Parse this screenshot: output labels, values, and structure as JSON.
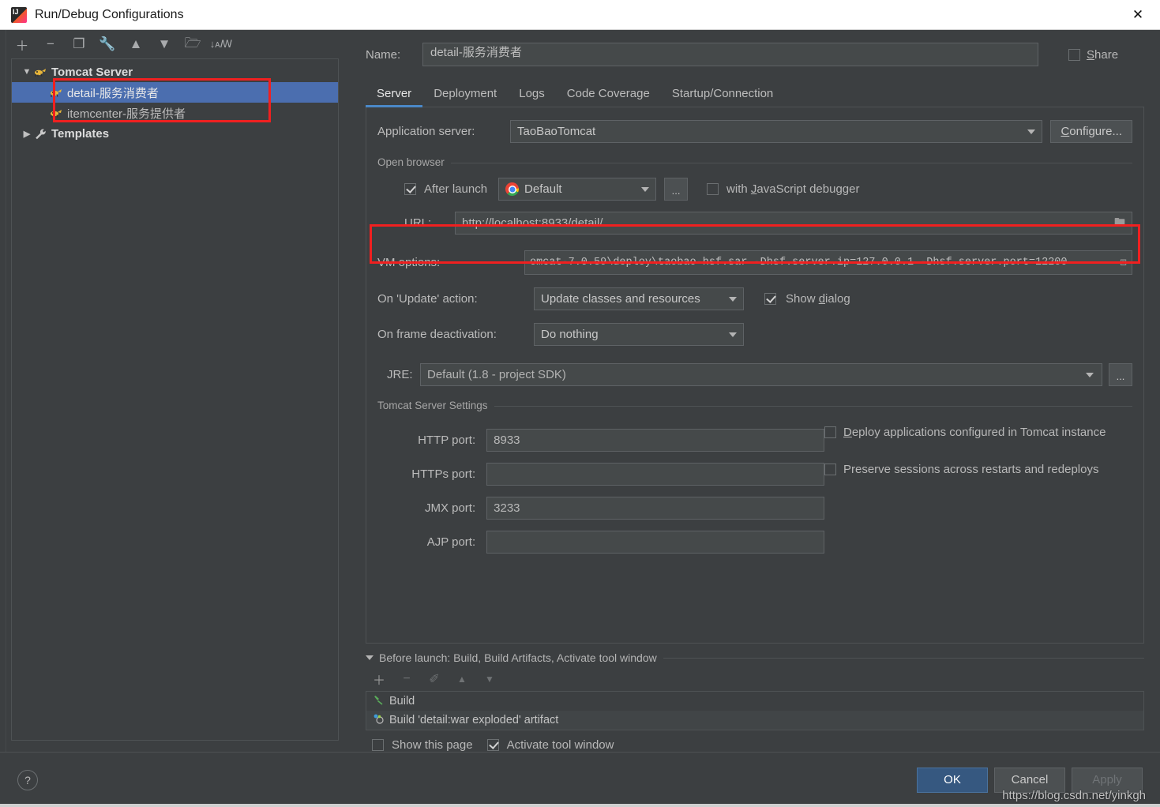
{
  "window": {
    "title": "Run/Debug Configurations",
    "app_icon": "intellij-idea-icon",
    "close_label": "✕"
  },
  "sidebar": {
    "toolbar": [
      {
        "name": "add-configuration-button",
        "glyph": "＋"
      },
      {
        "name": "remove-configuration-button",
        "glyph": "−"
      },
      {
        "name": "copy-configuration-button",
        "glyph": "❐"
      },
      {
        "name": "edit-templates-button",
        "glyph": "🔧"
      },
      {
        "name": "move-up-button",
        "glyph": "▲"
      },
      {
        "name": "move-down-button",
        "glyph": "▼"
      },
      {
        "name": "new-folder-button",
        "glyph": "🗁"
      },
      {
        "name": "sort-alphabetically-button",
        "glyph": "↓ᴀꟿ"
      }
    ],
    "tree": [
      {
        "label": "Tomcat Server",
        "type": "root",
        "expanded": true,
        "icon": "tomcat-icon"
      },
      {
        "label": "detail-服务消费者",
        "type": "child",
        "selected": true,
        "icon": "tomcat-icon"
      },
      {
        "label": "itemcenter-服务提供者",
        "type": "child",
        "selected": false,
        "icon": "tomcat-icon"
      },
      {
        "label": "Templates",
        "type": "root",
        "expanded": false,
        "icon": "wrench-icon"
      }
    ]
  },
  "header": {
    "name_label": "Name:",
    "name_value": "detail-服务消费者",
    "share_label": "Share",
    "share_checked": false
  },
  "tabs": [
    {
      "label": "Server",
      "active": true
    },
    {
      "label": "Deployment",
      "active": false
    },
    {
      "label": "Logs",
      "active": false
    },
    {
      "label": "Code Coverage",
      "active": false
    },
    {
      "label": "Startup/Connection",
      "active": false
    }
  ],
  "server": {
    "application_server_label": "Application server:",
    "application_server_value": "TaoBaoTomcat",
    "configure_button": "Configure...",
    "open_browser": {
      "group_title": "Open browser",
      "after_launch_label": "After launch",
      "after_launch_checked": true,
      "browser_value": "Default",
      "browser_icon": "chrome-icon",
      "browse_button": "...",
      "js_debugger_label": "with JavaScript debugger",
      "js_debugger_checked": false,
      "url_label": "URL:",
      "url_value": "http://localhost:8933/detail/",
      "url_folder_icon": "folder-icon"
    },
    "vm_options_label": "VM options:",
    "vm_options_value": "omcat-7.0.59\\deploy\\taobao-hsf.sar -Dhsf.server.ip=127.0.0.1 -Dhsf.server.port=12200",
    "vm_options_expand_icon": "expand-icon",
    "on_update_label": "On 'Update' action:",
    "on_update_value": "Update classes and resources",
    "show_dialog_label": "Show dialog",
    "show_dialog_checked": true,
    "on_frame_deactivation_label": "On frame deactivation:",
    "on_frame_deactivation_value": "Do nothing",
    "jre_label": "JRE:",
    "jre_value": "Default (1.8 - project SDK)",
    "jre_browse_button": "...",
    "tomcat_settings": {
      "group_title": "Tomcat Server Settings",
      "ports": [
        {
          "label": "HTTP port:",
          "value": "8933"
        },
        {
          "label": "HTTPs port:",
          "value": ""
        },
        {
          "label": "JMX port:",
          "value": "3233"
        },
        {
          "label": "AJP port:",
          "value": ""
        }
      ],
      "checkboxes": [
        {
          "label": "Deploy applications configured in Tomcat instance",
          "checked": false
        },
        {
          "label": "Preserve sessions across restarts and redeploys",
          "checked": false
        }
      ]
    }
  },
  "before_launch": {
    "title": "Before launch: Build, Build Artifacts, Activate tool window",
    "toolbar": [
      {
        "name": "add-task-button",
        "glyph": "＋",
        "enabled": true
      },
      {
        "name": "remove-task-button",
        "glyph": "−",
        "enabled": false
      },
      {
        "name": "edit-task-button",
        "glyph": "✐",
        "enabled": false
      },
      {
        "name": "move-task-up-button",
        "glyph": "▲",
        "enabled": false
      },
      {
        "name": "move-task-down-button",
        "glyph": "▼",
        "enabled": false
      }
    ],
    "items": [
      {
        "label": "Build",
        "icon": "build-hammer-icon"
      },
      {
        "label": "Build 'detail:war exploded' artifact",
        "icon": "artifact-icon"
      }
    ],
    "show_this_page_label": "Show this page",
    "show_this_page_checked": false,
    "activate_tool_window_label": "Activate tool window",
    "activate_tool_window_checked": true
  },
  "footer": {
    "help_icon": "help-icon",
    "buttons": [
      {
        "label": "OK",
        "style": "primary"
      },
      {
        "label": "Cancel",
        "style": "normal"
      },
      {
        "label": "Apply",
        "style": "disabled"
      }
    ]
  },
  "watermark": "https://blog.csdn.net/yinkgh",
  "colors": {
    "window_bg": "#3c3f41",
    "field_bg": "#45494a",
    "border": "#5e6265",
    "selection": "#4b6eaf",
    "accent_tab": "#4a88c7",
    "primary_button": "#365880",
    "highlight_red": "#f02020",
    "text": "#bbbbbb"
  }
}
